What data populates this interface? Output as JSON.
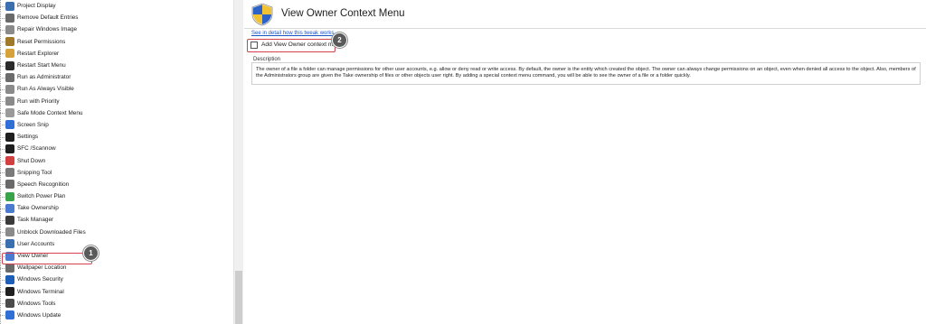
{
  "tree": {
    "items": [
      {
        "label": "Project Display",
        "icon": "monitor-icon",
        "color": "#3a6fb0"
      },
      {
        "label": "Remove Default Entries",
        "icon": "list-icon",
        "color": "#6a6a6a"
      },
      {
        "label": "Repair Windows Image",
        "icon": "tools-icon",
        "color": "#8a8a8a"
      },
      {
        "label": "Reset Permissions",
        "icon": "key-icon",
        "color": "#a07a2a"
      },
      {
        "label": "Restart Explorer",
        "icon": "folder-icon",
        "color": "#d8a23a"
      },
      {
        "label": "Restart Start Menu",
        "icon": "start-icon",
        "color": "#2b2b2b"
      },
      {
        "label": "Run as Administrator",
        "icon": "admin-icon",
        "color": "#6b6b6b"
      },
      {
        "label": "Run As Always Visible",
        "icon": "window-icon",
        "color": "#8a8a8a"
      },
      {
        "label": "Run with Priority",
        "icon": "priority-icon",
        "color": "#8a8a8a"
      },
      {
        "label": "Safe Mode Context Menu",
        "icon": "safemode-icon",
        "color": "#9a9a9a"
      },
      {
        "label": "Screen Snip",
        "icon": "snip-icon",
        "color": "#2f6fd6"
      },
      {
        "label": "Settings",
        "icon": "gear-icon",
        "color": "#1f1f1f"
      },
      {
        "label": "SFC /Scannow",
        "icon": "terminal-icon",
        "color": "#1f1f1f"
      },
      {
        "label": "Shut Down",
        "icon": "power-icon",
        "color": "#d24040"
      },
      {
        "label": "Snipping Tool",
        "icon": "scissors-icon",
        "color": "#7a7a7a"
      },
      {
        "label": "Speech Recognition",
        "icon": "mic-icon",
        "color": "#6a6a6a"
      },
      {
        "label": "Switch Power Plan",
        "icon": "battery-icon",
        "color": "#3aa34a"
      },
      {
        "label": "Take Ownership",
        "icon": "ownership-icon",
        "color": "#4a7bd0"
      },
      {
        "label": "Task Manager",
        "icon": "taskmanager-icon",
        "color": "#3a3a3a"
      },
      {
        "label": "Unblock Downloaded Files",
        "icon": "unblock-icon",
        "color": "#8a8a8a"
      },
      {
        "label": "User Accounts",
        "icon": "user-icon",
        "color": "#3a6fb0"
      },
      {
        "label": "View Owner",
        "icon": "view-owner-icon",
        "color": "#4a7bd0",
        "selected": true
      },
      {
        "label": "Wallpaper Location",
        "icon": "wallpaper-icon",
        "color": "#6a6a6a"
      },
      {
        "label": "Windows Security",
        "icon": "shield-icon",
        "color": "#1d5fb8"
      },
      {
        "label": "Windows Terminal",
        "icon": "terminal-icon",
        "color": "#1f1f1f"
      },
      {
        "label": "Windows Tools",
        "icon": "tools-icon",
        "color": "#4a4a4a"
      },
      {
        "label": "Windows Update",
        "icon": "update-icon",
        "color": "#2f6fd6"
      }
    ]
  },
  "badges": {
    "one": "1",
    "two": "2"
  },
  "content": {
    "title": "View Owner Context Menu",
    "link": "See in detail how this tweak works",
    "checkbox_label": "Add View Owner context menu",
    "description_label": "Description",
    "description": "The owner of a file a folder can manage permissions for other user accounts, e.g. allow or deny read or write access. By default, the owner is the entity which created the object. The owner can always change permissions on an object, even when denied all access to the object. Also, members of the Administrators group are given the Take ownership of files or other objects user right. By adding a special context menu command, you will be able to see the owner of a file or a folder quickly."
  },
  "colors": {
    "accent_red": "#d6404f",
    "link_blue": "#1a55c4",
    "badge_gray": "#5a5a5a"
  }
}
